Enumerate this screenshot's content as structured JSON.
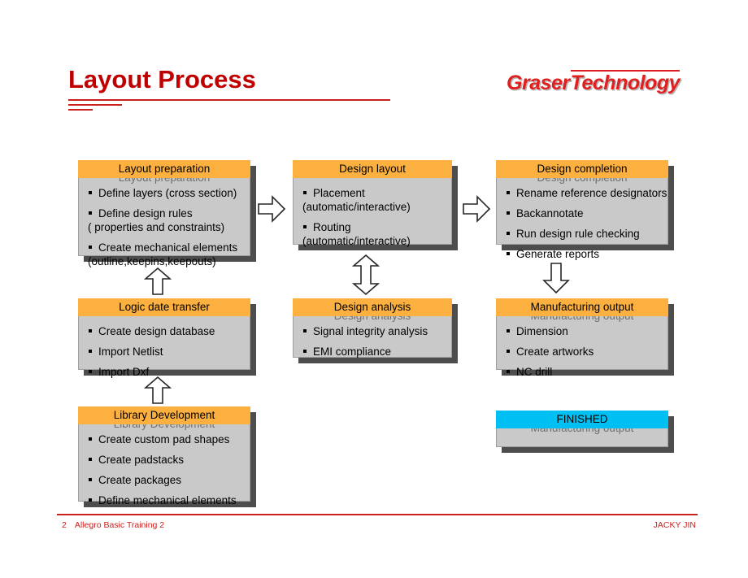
{
  "slide": {
    "title": "Layout Process",
    "logo": {
      "word1": "Graser",
      "word2": "Technology"
    },
    "accent_color": "#C9211E",
    "header_color": "#FBB040",
    "finished_color": "#00BFF3",
    "body_color": "#C9C9C9",
    "shadow_color": "#4D4D4D"
  },
  "boxes": {
    "layout_preparation": {
      "title": "Layout preparation",
      "ghost": "Layout preparation",
      "items": [
        {
          "main": "Define layers (cross section)",
          "sub": ""
        },
        {
          "main": "Define design rules",
          "sub": "( properties and constraints)"
        },
        {
          "main": "Create mechanical elements",
          "sub": "(outline,keepins,keepouts)"
        }
      ]
    },
    "design_layout": {
      "title": "Design layout",
      "ghost": "",
      "items": [
        {
          "main": "Placement",
          "sub": "(automatic/interactive)"
        },
        {
          "main": "Routing",
          "sub": "(automatic/interactive)"
        }
      ]
    },
    "design_completion": {
      "title": "Design completion",
      "ghost": "Design completion",
      "items": [
        {
          "main": "Rename reference designators",
          "sub": ""
        },
        {
          "main": "Backannotate",
          "sub": ""
        },
        {
          "main": "Run design rule checking",
          "sub": ""
        },
        {
          "main": "Generate reports",
          "sub": ""
        }
      ]
    },
    "logic_date_transfer": {
      "title": "Logic date transfer",
      "ghost": "",
      "items": [
        {
          "main": "Create design database",
          "sub": ""
        },
        {
          "main": "Import Netlist",
          "sub": ""
        },
        {
          "main": "Import Dxf",
          "sub": ""
        }
      ]
    },
    "design_analysis": {
      "title": "Design analysis",
      "ghost": "Design analysis",
      "items": [
        {
          "main": "Signal integrity analysis",
          "sub": ""
        },
        {
          "main": "EMI compliance",
          "sub": ""
        }
      ]
    },
    "manufacturing_output": {
      "title": "Manufacturing output",
      "ghost": "Manufacturing output",
      "items": [
        {
          "main": "Dimension",
          "sub": ""
        },
        {
          "main": "Create artworks",
          "sub": ""
        },
        {
          "main": "NC drill",
          "sub": ""
        }
      ]
    },
    "library_development": {
      "title": "Library Development",
      "ghost": "Library Development",
      "items": [
        {
          "main": "Create custom pad shapes",
          "sub": ""
        },
        {
          "main": "Create padstacks",
          "sub": ""
        },
        {
          "main": "Create packages",
          "sub": ""
        },
        {
          "main": "Define mechanical elements",
          "sub": ""
        }
      ]
    },
    "finished": {
      "title": "FINISHED",
      "ghost": "Manufacturing output",
      "items": []
    }
  },
  "arrows": {
    "prep_to_layout": "arrow-right-icon",
    "layout_to_completion": "arrow-right-icon",
    "logic_to_prep": "arrow-up-icon",
    "library_to_logic": "arrow-up-icon",
    "layout_analysis": "arrow-up-down-icon",
    "completion_to_manufacturing": "arrow-down-icon"
  },
  "footer": {
    "page_number": "2",
    "deck_title": "Allegro Basic Training 2",
    "author": "JACKY JIN"
  }
}
